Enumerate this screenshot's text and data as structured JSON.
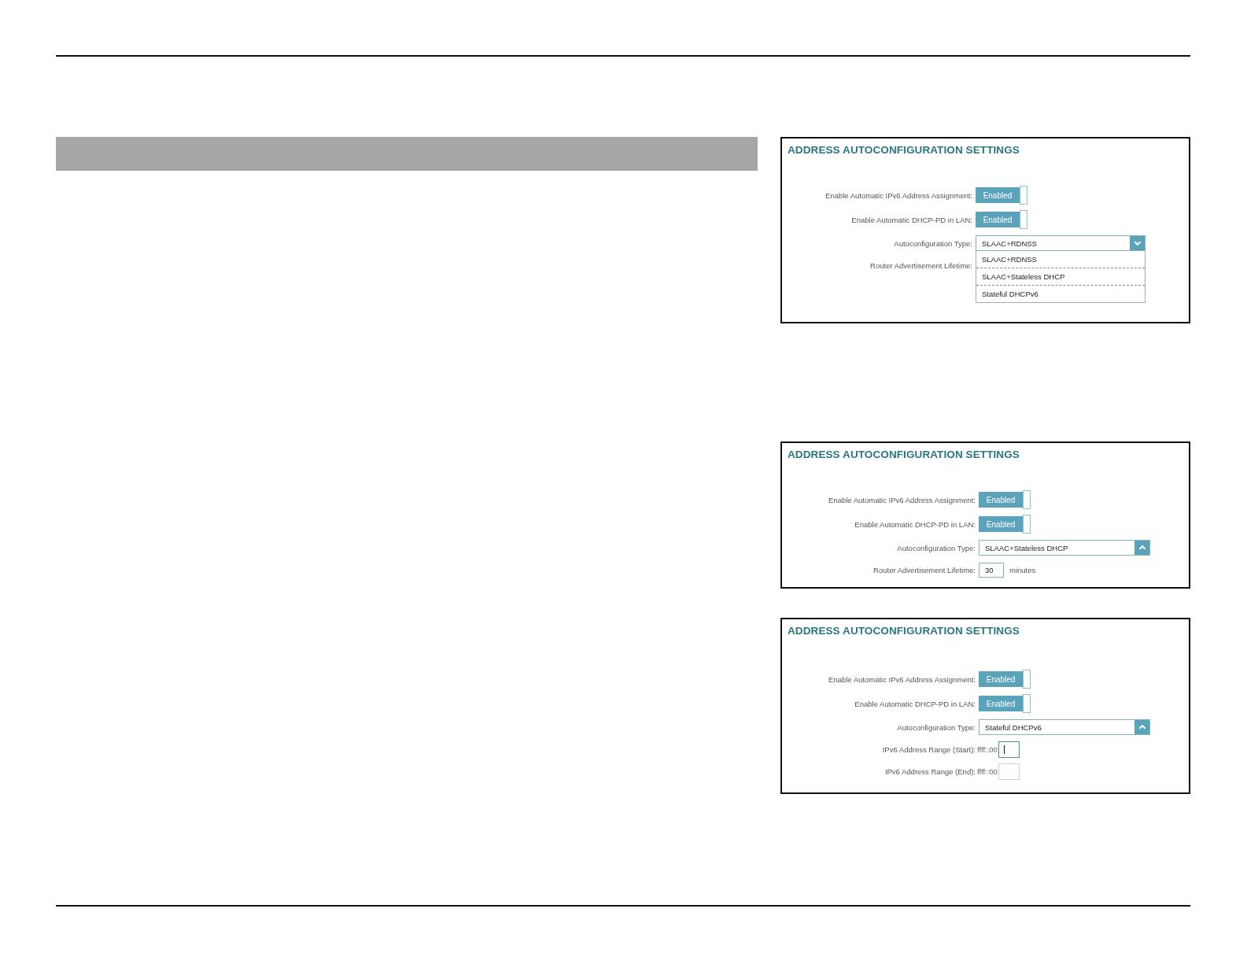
{
  "panels": [
    {
      "title": "ADDRESS AUTOCONFIGURATION SETTINGS",
      "rows": [
        {
          "kind": "toggle",
          "label": "Enable Automatic IPv6 Address Assignment:",
          "value": "Enabled",
          "on": true
        },
        {
          "kind": "toggle",
          "label": "Enable Automatic DHCP-PD in LAN:",
          "value": "Enabled",
          "on": true
        },
        {
          "kind": "select",
          "label": "Autoconfiguration Type:",
          "value": "SLAAC+RDNSS",
          "expanded": true,
          "options": [
            {
              "label": "SLAAC+RDNSS"
            },
            {
              "label": "SLAAC+Stateless DHCP"
            },
            {
              "label": "Stateful DHCPv6"
            }
          ]
        },
        {
          "kind": "label",
          "label": "Router Advertisement Lifetime:"
        }
      ]
    },
    {
      "title": "ADDRESS AUTOCONFIGURATION SETTINGS",
      "rows": [
        {
          "kind": "toggle",
          "label": "Enable Automatic IPv6 Address Assignment:",
          "value": "Enabled",
          "on": true
        },
        {
          "kind": "toggle",
          "label": "Enable Automatic DHCP-PD in LAN:",
          "value": "Enabled",
          "on": true
        },
        {
          "kind": "select",
          "label": "Autoconfiguration Type:",
          "value": "SLAAC+Stateless DHCP",
          "expanded": false
        },
        {
          "kind": "number",
          "label": "Router Advertisement Lifetime:",
          "value": "30",
          "unit": "minutes"
        }
      ]
    },
    {
      "title": "ADDRESS AUTOCONFIGURATION SETTINGS",
      "rows": [
        {
          "kind": "toggle",
          "label": "Enable Automatic IPv6 Address Assignment:",
          "value": "Enabled",
          "on": true
        },
        {
          "kind": "toggle",
          "label": "Enable Automatic DHCP-PD in LAN:",
          "value": "Enabled",
          "on": true
        },
        {
          "kind": "select",
          "label": "Autoconfiguration Type:",
          "value": "Stateful DHCPv6",
          "expanded": false
        },
        {
          "kind": "range",
          "label": "IPv6 Address Range (Start):",
          "prefix": "ffff::00",
          "focused": true
        },
        {
          "kind": "range",
          "label": "IPv6 Address Range (End):",
          "prefix": "ffff::00",
          "focused": false
        }
      ]
    }
  ]
}
